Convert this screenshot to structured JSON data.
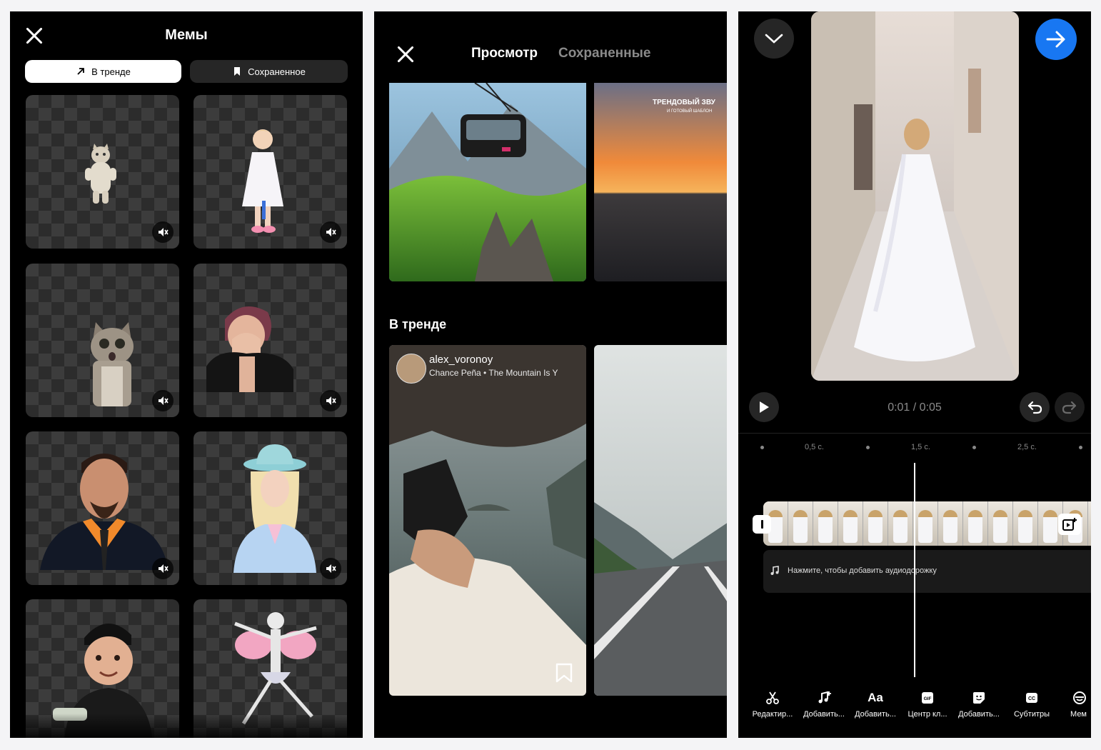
{
  "memes_panel": {
    "close_icon": "close-icon",
    "title": "Мемы",
    "tabs": [
      {
        "label": "В тренде",
        "icon": "trending-arrow-icon",
        "active": true
      },
      {
        "label": "Сохраненное",
        "icon": "bookmark-icon",
        "active": false
      }
    ],
    "stickers": [
      {
        "subject": "cat standing",
        "muted": true
      },
      {
        "subject": "little girl in white dress",
        "muted": true
      },
      {
        "subject": "surprised cat",
        "muted": true
      },
      {
        "subject": "person covering face",
        "muted": true
      },
      {
        "subject": "man in jacket",
        "muted": true
      },
      {
        "subject": "woman in hat",
        "muted": true
      },
      {
        "subject": "child in cap",
        "muted": false
      },
      {
        "subject": "dancing skeleton with wings",
        "muted": false
      }
    ]
  },
  "browse_panel": {
    "tabs": [
      {
        "label": "Просмотр",
        "active": true
      },
      {
        "label": "Сохраненные",
        "active": false
      }
    ],
    "top_row": [
      {
        "subject": "cable car over mountains"
      },
      {
        "subject": "sunset over sea",
        "overlay_title": "ТРЕНДОВЫЙ ЗВУ",
        "overlay_subtitle": "И ГОТОВЫЙ ШАБЛОН"
      }
    ],
    "section_title": "В тренде",
    "trending": [
      {
        "username": "alex_voronoy",
        "audio": "Chance Peña • The Mountain Is Y",
        "subject": "taking photo by sea",
        "bookmark_icon": "bookmark-outline-icon"
      },
      {
        "subject": "road through mountains"
      }
    ]
  },
  "editor_panel": {
    "collapse_icon": "chevron-down-icon",
    "next_icon": "arrow-right-icon",
    "accent": "#1877f2",
    "time": "0:01 / 0:05",
    "timeline_labels": [
      "0,5 с.",
      "1,5 с.",
      "2,5 с."
    ],
    "audio_hint": "Нажмите, чтобы добавить аудиодорожку",
    "toolbar": [
      {
        "label": "Редактир...",
        "icon": "scissors-icon"
      },
      {
        "label": "Добавить...",
        "icon": "music-add-icon"
      },
      {
        "label": "Добавить...",
        "icon": "text-icon"
      },
      {
        "label": "Центр кл...",
        "icon": "gif-icon"
      },
      {
        "label": "Добавить...",
        "icon": "sticker-icon"
      },
      {
        "label": "Субтитры",
        "icon": "cc-icon"
      },
      {
        "label": "Мем",
        "icon": "meme-icon"
      }
    ]
  }
}
